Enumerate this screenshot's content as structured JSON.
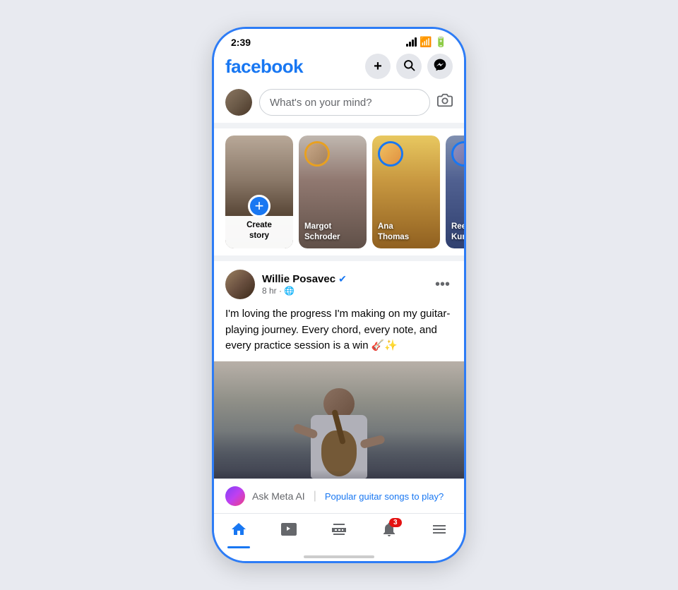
{
  "statusBar": {
    "time": "2:39",
    "hasDot": true
  },
  "header": {
    "logo": "facebook",
    "addLabel": "+",
    "searchLabel": "🔍",
    "messengerLabel": "m"
  },
  "postInput": {
    "placeholder": "What's on your mind?"
  },
  "stories": [
    {
      "id": "create",
      "type": "create",
      "label1": "Create",
      "label2": "story"
    },
    {
      "id": "margot",
      "type": "friend",
      "name": "Margot",
      "surname": "Schroder",
      "ringColor": "gold"
    },
    {
      "id": "ana",
      "type": "friend",
      "name": "Ana",
      "surname": "Thomas",
      "ringColor": "blue"
    },
    {
      "id": "reer",
      "type": "friend",
      "name": "Reer",
      "surname": "Kum...",
      "ringColor": "blue"
    }
  ],
  "post": {
    "authorName": "Willie Posavec",
    "verified": true,
    "meta": "8 hr · 🌐",
    "text": "I'm loving the progress I'm making on my guitar-playing journey. Every chord, every note, and every practice session is a win 🎸✨",
    "moreIcon": "···"
  },
  "metaAI": {
    "label": "Ask Meta AI",
    "suggestion": "Popular guitar songs to play?"
  },
  "bottomNav": {
    "items": [
      {
        "id": "home",
        "icon": "home",
        "active": true
      },
      {
        "id": "video",
        "icon": "video",
        "active": false
      },
      {
        "id": "marketplace",
        "icon": "marketplace",
        "active": false
      },
      {
        "id": "notifications",
        "icon": "bell",
        "active": false,
        "badge": "3"
      },
      {
        "id": "menu",
        "icon": "menu",
        "active": false
      }
    ]
  }
}
